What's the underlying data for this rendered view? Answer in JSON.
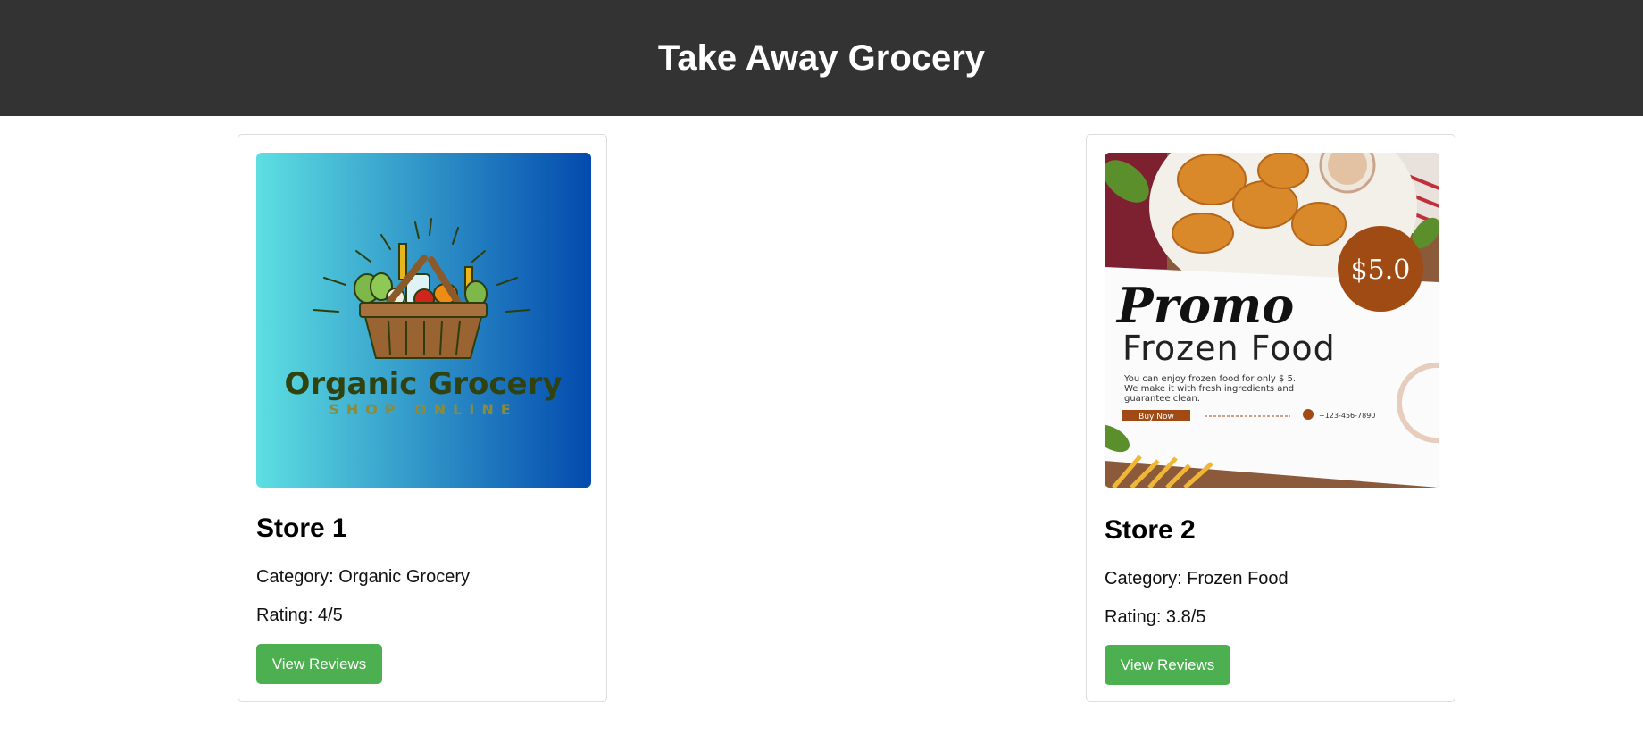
{
  "header": {
    "title": "Take Away Grocery"
  },
  "colors": {
    "header_bg": "#333333",
    "button_bg": "#4caf50",
    "card_border": "#dddddd"
  },
  "stores": [
    {
      "name": "Store 1",
      "category": "Category: Organic Grocery",
      "rating": "Rating: 4/5",
      "button_label": "View Reviews",
      "image": {
        "icon": "grocery-basket-logo",
        "brand_text": "Organic Grocery",
        "tagline": "SHOP ONLINE"
      }
    },
    {
      "name": "Store 2",
      "category": "Category: Frozen Food",
      "rating": "Rating: 3.8/5",
      "button_label": "View Reviews",
      "image": {
        "price": "$5.0",
        "headline_script": "Promo",
        "headline": "Frozen Food",
        "body_line1": "You can enjoy frozen food for only $ 5.",
        "body_line2": "We make it with fresh ingredients and",
        "body_line3": "guarantee clean.",
        "cta": "Buy Now",
        "phone": "+123-456-7890"
      }
    }
  ]
}
